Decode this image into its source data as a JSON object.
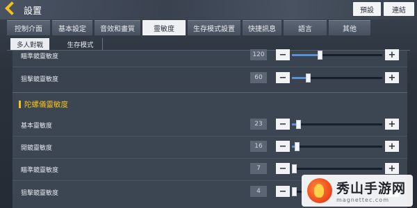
{
  "header": {
    "title": "設置",
    "preset_label": "預設",
    "connect_label": "連結"
  },
  "tabs": [
    {
      "label": "控制介面"
    },
    {
      "label": "基本設定"
    },
    {
      "label": "音效和畫質"
    },
    {
      "label": "靈敏度",
      "active": true
    },
    {
      "label": "生存模式設置"
    },
    {
      "label": "快捷訊息"
    },
    {
      "label": "語言"
    },
    {
      "label": "其他"
    }
  ],
  "subtabs": [
    {
      "label": "多人對戰",
      "active": true
    },
    {
      "label": "生存模式"
    }
  ],
  "scope_rows": [
    {
      "label": "瞄準鏡靈敏度",
      "value": "120",
      "fraction": 0.3
    },
    {
      "label": "狙擊鏡靈敏度",
      "value": "60",
      "fraction": 0.16
    }
  ],
  "gyro_section": {
    "title": "陀螺儀靈敏度",
    "rows": [
      {
        "label": "基本靈敏度",
        "value": "23",
        "fraction": 0.05
      },
      {
        "label": "開鏡靈敏度",
        "value": "16",
        "fraction": 0.03
      },
      {
        "label": "瞄準鏡靈敏度",
        "value": "7",
        "fraction": 0.0
      },
      {
        "label": "狙擊鏡靈敏度",
        "value": "4",
        "fraction": 0.0
      }
    ]
  },
  "stepper": {
    "minus": "−",
    "plus": "+"
  },
  "colors": {
    "accent": "#f3c21d",
    "track_fill": "#5b8fd6",
    "track": "#17202a"
  },
  "watermark": {
    "title": "秀山手游网",
    "url": "magnettec.com"
  }
}
